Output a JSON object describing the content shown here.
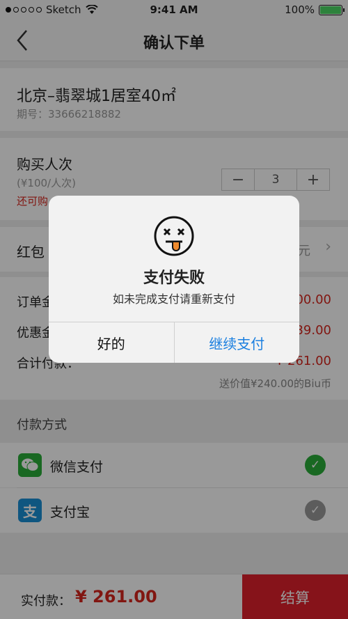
{
  "status_bar": {
    "carrier": "Sketch",
    "time": "9:41 AM",
    "battery": "100%"
  },
  "nav": {
    "back_icon": "chevron-left-icon",
    "title": "确认下单"
  },
  "product": {
    "name": "北京–翡翠城1居室40㎡",
    "period": "期号：33666218882"
  },
  "purchase": {
    "title": "购买人次",
    "unit_price": "(¥100/人次)",
    "remaining": "还可购",
    "quantity": "3",
    "minus": "−",
    "plus": "+"
  },
  "red_packet": {
    "label": "红包",
    "value": "元"
  },
  "amounts": {
    "order": {
      "label": "订单金",
      "value": "00.00"
    },
    "discount": {
      "label": "优惠金",
      "value": "39.00"
    },
    "total": {
      "label": "合计付款：",
      "value": "¥ 261.00"
    },
    "gift": "送价值¥240.00的Biu币"
  },
  "payment": {
    "header": "付款方式",
    "methods": [
      {
        "label": "微信支付",
        "icon": "wechat-icon",
        "icon_color": "#2aae3a",
        "selected": true
      },
      {
        "label": "支付宝",
        "icon": "alipay-icon",
        "icon_color": "#1a8fd6",
        "selected": false
      }
    ]
  },
  "bottom": {
    "label": "实付款：",
    "amount": "¥ 261.00",
    "settle": "结算"
  },
  "dialog": {
    "icon": "dizzy-face-icon",
    "title": "支付失败",
    "message": "如未完成支付请重新支付",
    "ok": "好的",
    "continue": "继续支付"
  },
  "colors": {
    "accent_red": "#d8261d",
    "link_blue": "#1a7fe0",
    "check_green": "#2aae3a"
  }
}
